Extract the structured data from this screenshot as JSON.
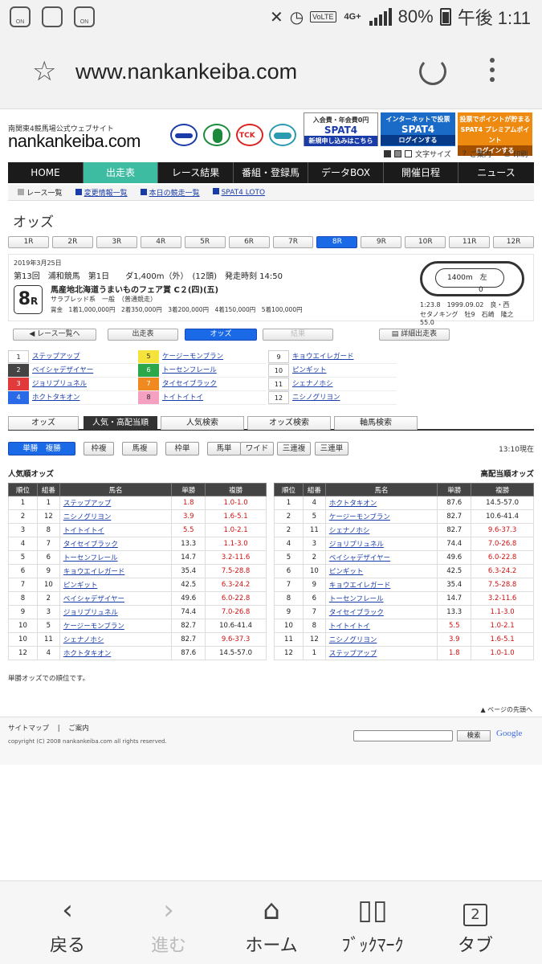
{
  "status": {
    "signal_label": "4G+",
    "volte": "VoLTE",
    "battery": "80%",
    "time": "午後 1:11",
    "on1": "ON",
    "on2": "ON"
  },
  "browser": {
    "url": "www.nankankeiba.com"
  },
  "site": {
    "tagline": "南関東4競馬場公式ウェブサイト",
    "logo": "nankankeiba.com",
    "banner1": {
      "t1": "入会費・年会費0円",
      "t2": "SPAT4",
      "t3": "新規申し込みはこちら"
    },
    "banner2": {
      "t1": "インターネットで投票",
      "t2": "SPAT4",
      "t3": "ログインする"
    },
    "banner3": {
      "t1": "投票でポイントが貯まる",
      "t2": "SPAT4 プレミアムポイント",
      "t3": "ログインする"
    },
    "util_fontsize": "文字サイズ",
    "util_guide": "ご案内",
    "util_print": "印刷"
  },
  "gnav": [
    "HOME",
    "出走表",
    "レース結果",
    "番組・登録馬",
    "データBOX",
    "開催日程",
    "ニュース"
  ],
  "subnav": [
    "レース一覧",
    "変更情報一覧",
    "本日の競走一覧",
    "SPAT4 LOTO"
  ],
  "section_title": "オッズ",
  "race_tabs": [
    "1R",
    "2R",
    "3R",
    "4R",
    "5R",
    "6R",
    "7R",
    "8R",
    "9R",
    "10R",
    "11R",
    "12R"
  ],
  "race": {
    "date": "2019年3月25日",
    "kai": "第13回　浦和競馬　第1日　　ダ1,400m（外）　(12頭)　発走時刻 14:50",
    "num": "8",
    "num_unit": "R",
    "name": "馬産地北海道うまいものフェア賞 C２(四)(五)",
    "cls": "サラブレッド系　一般　（普通競走）",
    "prize": "賞金　1着1,000,000円　2着350,000円　3着200,000円　4着150,000円　5着100,000円",
    "course": "1400m　左",
    "course2": "0",
    "record1": "1:23.8　1999.09.02　良・西",
    "record2": "セタノキング　牡9　石崎　隆之　55.0"
  },
  "buttons": {
    "list": "レース一覧へ",
    "entries": "出走表",
    "odds": "オッズ",
    "result": "結果",
    "detail": "詳細出走表"
  },
  "horses": [
    {
      "no": "1",
      "name": "ステップアップ"
    },
    {
      "no": "2",
      "name": "ベイシャデザイヤー"
    },
    {
      "no": "3",
      "name": "ジョリプリュネル"
    },
    {
      "no": "4",
      "name": "ホクトタキオン"
    },
    {
      "no": "5",
      "name": "ケージーモンブラン"
    },
    {
      "no": "6",
      "name": "トーセンフレール"
    },
    {
      "no": "7",
      "name": "タイセイブラック"
    },
    {
      "no": "8",
      "name": "トイトイトイ"
    },
    {
      "no": "9",
      "name": "キョウエイレガード"
    },
    {
      "no": "10",
      "name": "ピンギット"
    },
    {
      "no": "11",
      "name": "シェナノホシ"
    },
    {
      "no": "12",
      "name": "ニシノグリヨン"
    }
  ],
  "odds_tabs": [
    "オッズ",
    "人気・高配当順",
    "人気検索",
    "オッズ検索",
    "軸馬検索"
  ],
  "bet_types": [
    "単勝　複勝",
    "枠複",
    "馬複",
    "枠単",
    "馬単",
    "ワイド",
    "三連複",
    "三連単"
  ],
  "time_now": "13:10現在",
  "left_title": "人気順オッズ",
  "right_title": "高配当順オッズ",
  "table_headers": [
    "順位",
    "組番",
    "馬名",
    "単勝",
    "複勝"
  ],
  "popular": [
    {
      "rank": "1",
      "no": "1",
      "name": "ステップアップ",
      "win": "1.8",
      "place": "1.0-1.0"
    },
    {
      "rank": "2",
      "no": "12",
      "name": "ニシノグリヨン",
      "win": "3.9",
      "place": "1.6-5.1"
    },
    {
      "rank": "3",
      "no": "8",
      "name": "トイトイトイ",
      "win": "5.5",
      "place": "1.0-2.1"
    },
    {
      "rank": "4",
      "no": "7",
      "name": "タイセイブラック",
      "win": "13.3",
      "place": "1.1-3.0"
    },
    {
      "rank": "5",
      "no": "6",
      "name": "トーセンフレール",
      "win": "14.7",
      "place": "3.2-11.6"
    },
    {
      "rank": "6",
      "no": "9",
      "name": "キョウエイレガード",
      "win": "35.4",
      "place": "7.5-28.8"
    },
    {
      "rank": "7",
      "no": "10",
      "name": "ピンギット",
      "win": "42.5",
      "place": "6.3-24.2"
    },
    {
      "rank": "8",
      "no": "2",
      "name": "ベイシャデザイヤー",
      "win": "49.6",
      "place": "6.0-22.8"
    },
    {
      "rank": "9",
      "no": "3",
      "name": "ジョリプリュネル",
      "win": "74.4",
      "place": "7.0-26.8"
    },
    {
      "rank": "10",
      "no": "5",
      "name": "ケージーモンブラン",
      "win": "82.7",
      "place": "10.6-41.4"
    },
    {
      "rank": "10",
      "no": "11",
      "name": "シェナノホシ",
      "win": "82.7",
      "place": "9.6-37.3"
    },
    {
      "rank": "12",
      "no": "4",
      "name": "ホクトタキオン",
      "win": "87.6",
      "place": "14.5-57.0"
    }
  ],
  "high": [
    {
      "rank": "1",
      "no": "4",
      "name": "ホクトタキオン",
      "win": "87.6",
      "place": "14.5-57.0"
    },
    {
      "rank": "2",
      "no": "5",
      "name": "ケージーモンブラン",
      "win": "82.7",
      "place": "10.6-41.4"
    },
    {
      "rank": "2",
      "no": "11",
      "name": "シェナノホシ",
      "win": "82.7",
      "place": "9.6-37.3"
    },
    {
      "rank": "4",
      "no": "3",
      "name": "ジョリプリュネル",
      "win": "74.4",
      "place": "7.0-26.8"
    },
    {
      "rank": "5",
      "no": "2",
      "name": "ベイシャデザイヤー",
      "win": "49.6",
      "place": "6.0-22.8"
    },
    {
      "rank": "6",
      "no": "10",
      "name": "ピンギット",
      "win": "42.5",
      "place": "6.3-24.2"
    },
    {
      "rank": "7",
      "no": "9",
      "name": "キョウエイレガード",
      "win": "35.4",
      "place": "7.5-28.8"
    },
    {
      "rank": "8",
      "no": "6",
      "name": "トーセンフレール",
      "win": "14.7",
      "place": "3.2-11.6"
    },
    {
      "rank": "9",
      "no": "7",
      "name": "タイセイブラック",
      "win": "13.3",
      "place": "1.1-3.0"
    },
    {
      "rank": "10",
      "no": "8",
      "name": "トイトイトイ",
      "win": "5.5",
      "place": "1.0-2.1"
    },
    {
      "rank": "11",
      "no": "12",
      "name": "ニシノグリヨン",
      "win": "3.9",
      "place": "1.6-5.1"
    },
    {
      "rank": "12",
      "no": "1",
      "name": "ステップアップ",
      "win": "1.8",
      "place": "1.0-1.0"
    }
  ],
  "note": "単勝オッズでの順位です。",
  "pagetop": "ページの先頭へ",
  "footer": {
    "sitemap": "サイトマップ",
    "guide": "ご案内",
    "copyright": "copyright (C) 2008 nankankeiba.com all rights reserved.",
    "search_btn": "検索",
    "google": "Google"
  },
  "bottom_nav": [
    "戻る",
    "進む",
    "ホーム",
    "ﾌﾞｯｸﾏｰｸ",
    "タブ"
  ],
  "tab_count": "2",
  "colors": {
    "accent_teal": "#3dbca2",
    "active_blue": "#1a6ae8",
    "nav_dark": "#1b1b1b",
    "odds_red": "#d01010"
  }
}
